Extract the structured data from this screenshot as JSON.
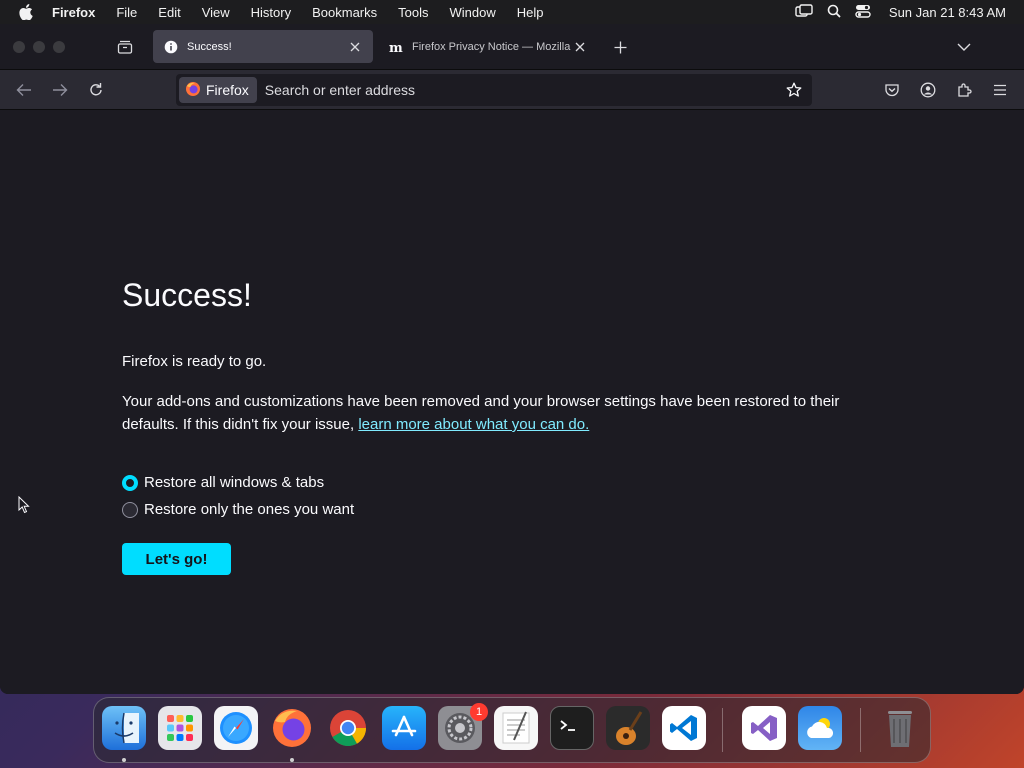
{
  "menubar": {
    "app_name": "Firefox",
    "items": [
      "File",
      "Edit",
      "View",
      "History",
      "Bookmarks",
      "Tools",
      "Window",
      "Help"
    ],
    "clock": "Sun Jan 21  8:43 AM"
  },
  "tabs": [
    {
      "title": "Success!",
      "active": true
    },
    {
      "title": "Firefox Privacy Notice — Mozilla",
      "active": false
    }
  ],
  "urlbar": {
    "identity_label": "Firefox",
    "placeholder": "Search or enter address"
  },
  "page": {
    "title": "Success!",
    "ready_text": "Firefox is ready to go.",
    "description": "Your add-ons and customizations have been removed and your browser settings have been restored to their defaults. If this didn't fix your issue, ",
    "link_text": "learn more about what you can do.",
    "radio_all": "Restore all windows & tabs",
    "radio_some": "Restore only the ones you want",
    "button_label": "Let's go!"
  },
  "dock": {
    "settings_badge": "1",
    "apps": [
      "Finder",
      "Launchpad",
      "Safari",
      "Firefox",
      "Chrome",
      "App Store",
      "System Settings",
      "TextEdit",
      "Terminal",
      "GarageBand",
      "VS Code",
      "Visual Studio",
      "Weather",
      "Trash"
    ]
  },
  "colors": {
    "accent": "#00ddff",
    "link": "#80ebff",
    "page_bg": "#1c1b22",
    "toolbar_bg": "#2b2a33"
  }
}
